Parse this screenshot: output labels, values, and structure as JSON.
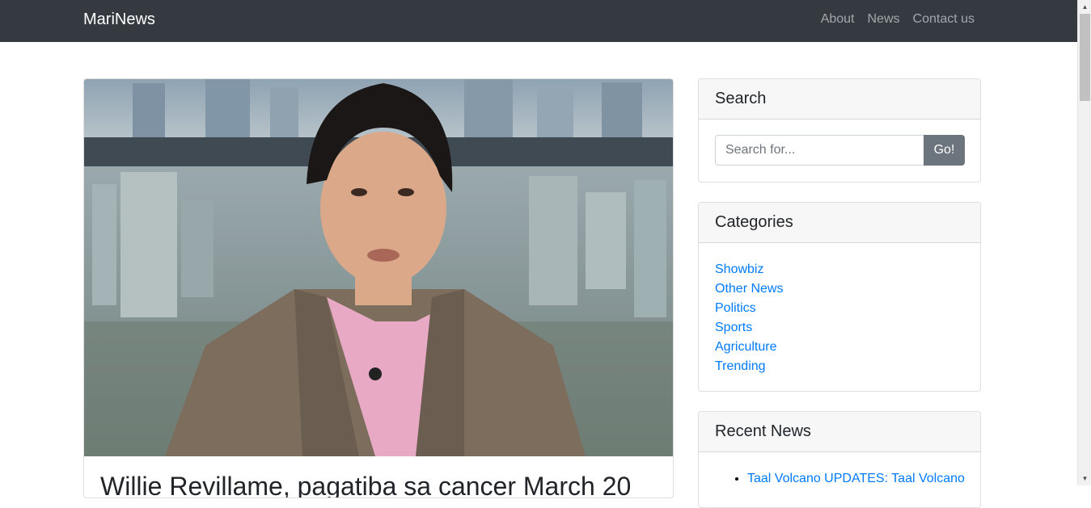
{
  "navbar": {
    "brand": "MariNews",
    "links": [
      "About",
      "News",
      "Contact us"
    ]
  },
  "post": {
    "image_alt": "Man in tan blazer and pink shirt speaking in front of a city skyline",
    "title": "Willie Revillame, pagatiba sa cancer March 20"
  },
  "search": {
    "header": "Search",
    "placeholder": "Search for...",
    "button": "Go!"
  },
  "categories": {
    "header": "Categories",
    "items": [
      "Showbiz",
      "Other News",
      "Politics",
      "Sports",
      "Agriculture",
      "Trending"
    ]
  },
  "recent": {
    "header": "Recent News",
    "items": [
      "Taal Volcano UPDATES: Taal Volcano"
    ]
  },
  "colors": {
    "navbar": "#343a40",
    "link": "#007bff",
    "button": "#6c757d"
  }
}
